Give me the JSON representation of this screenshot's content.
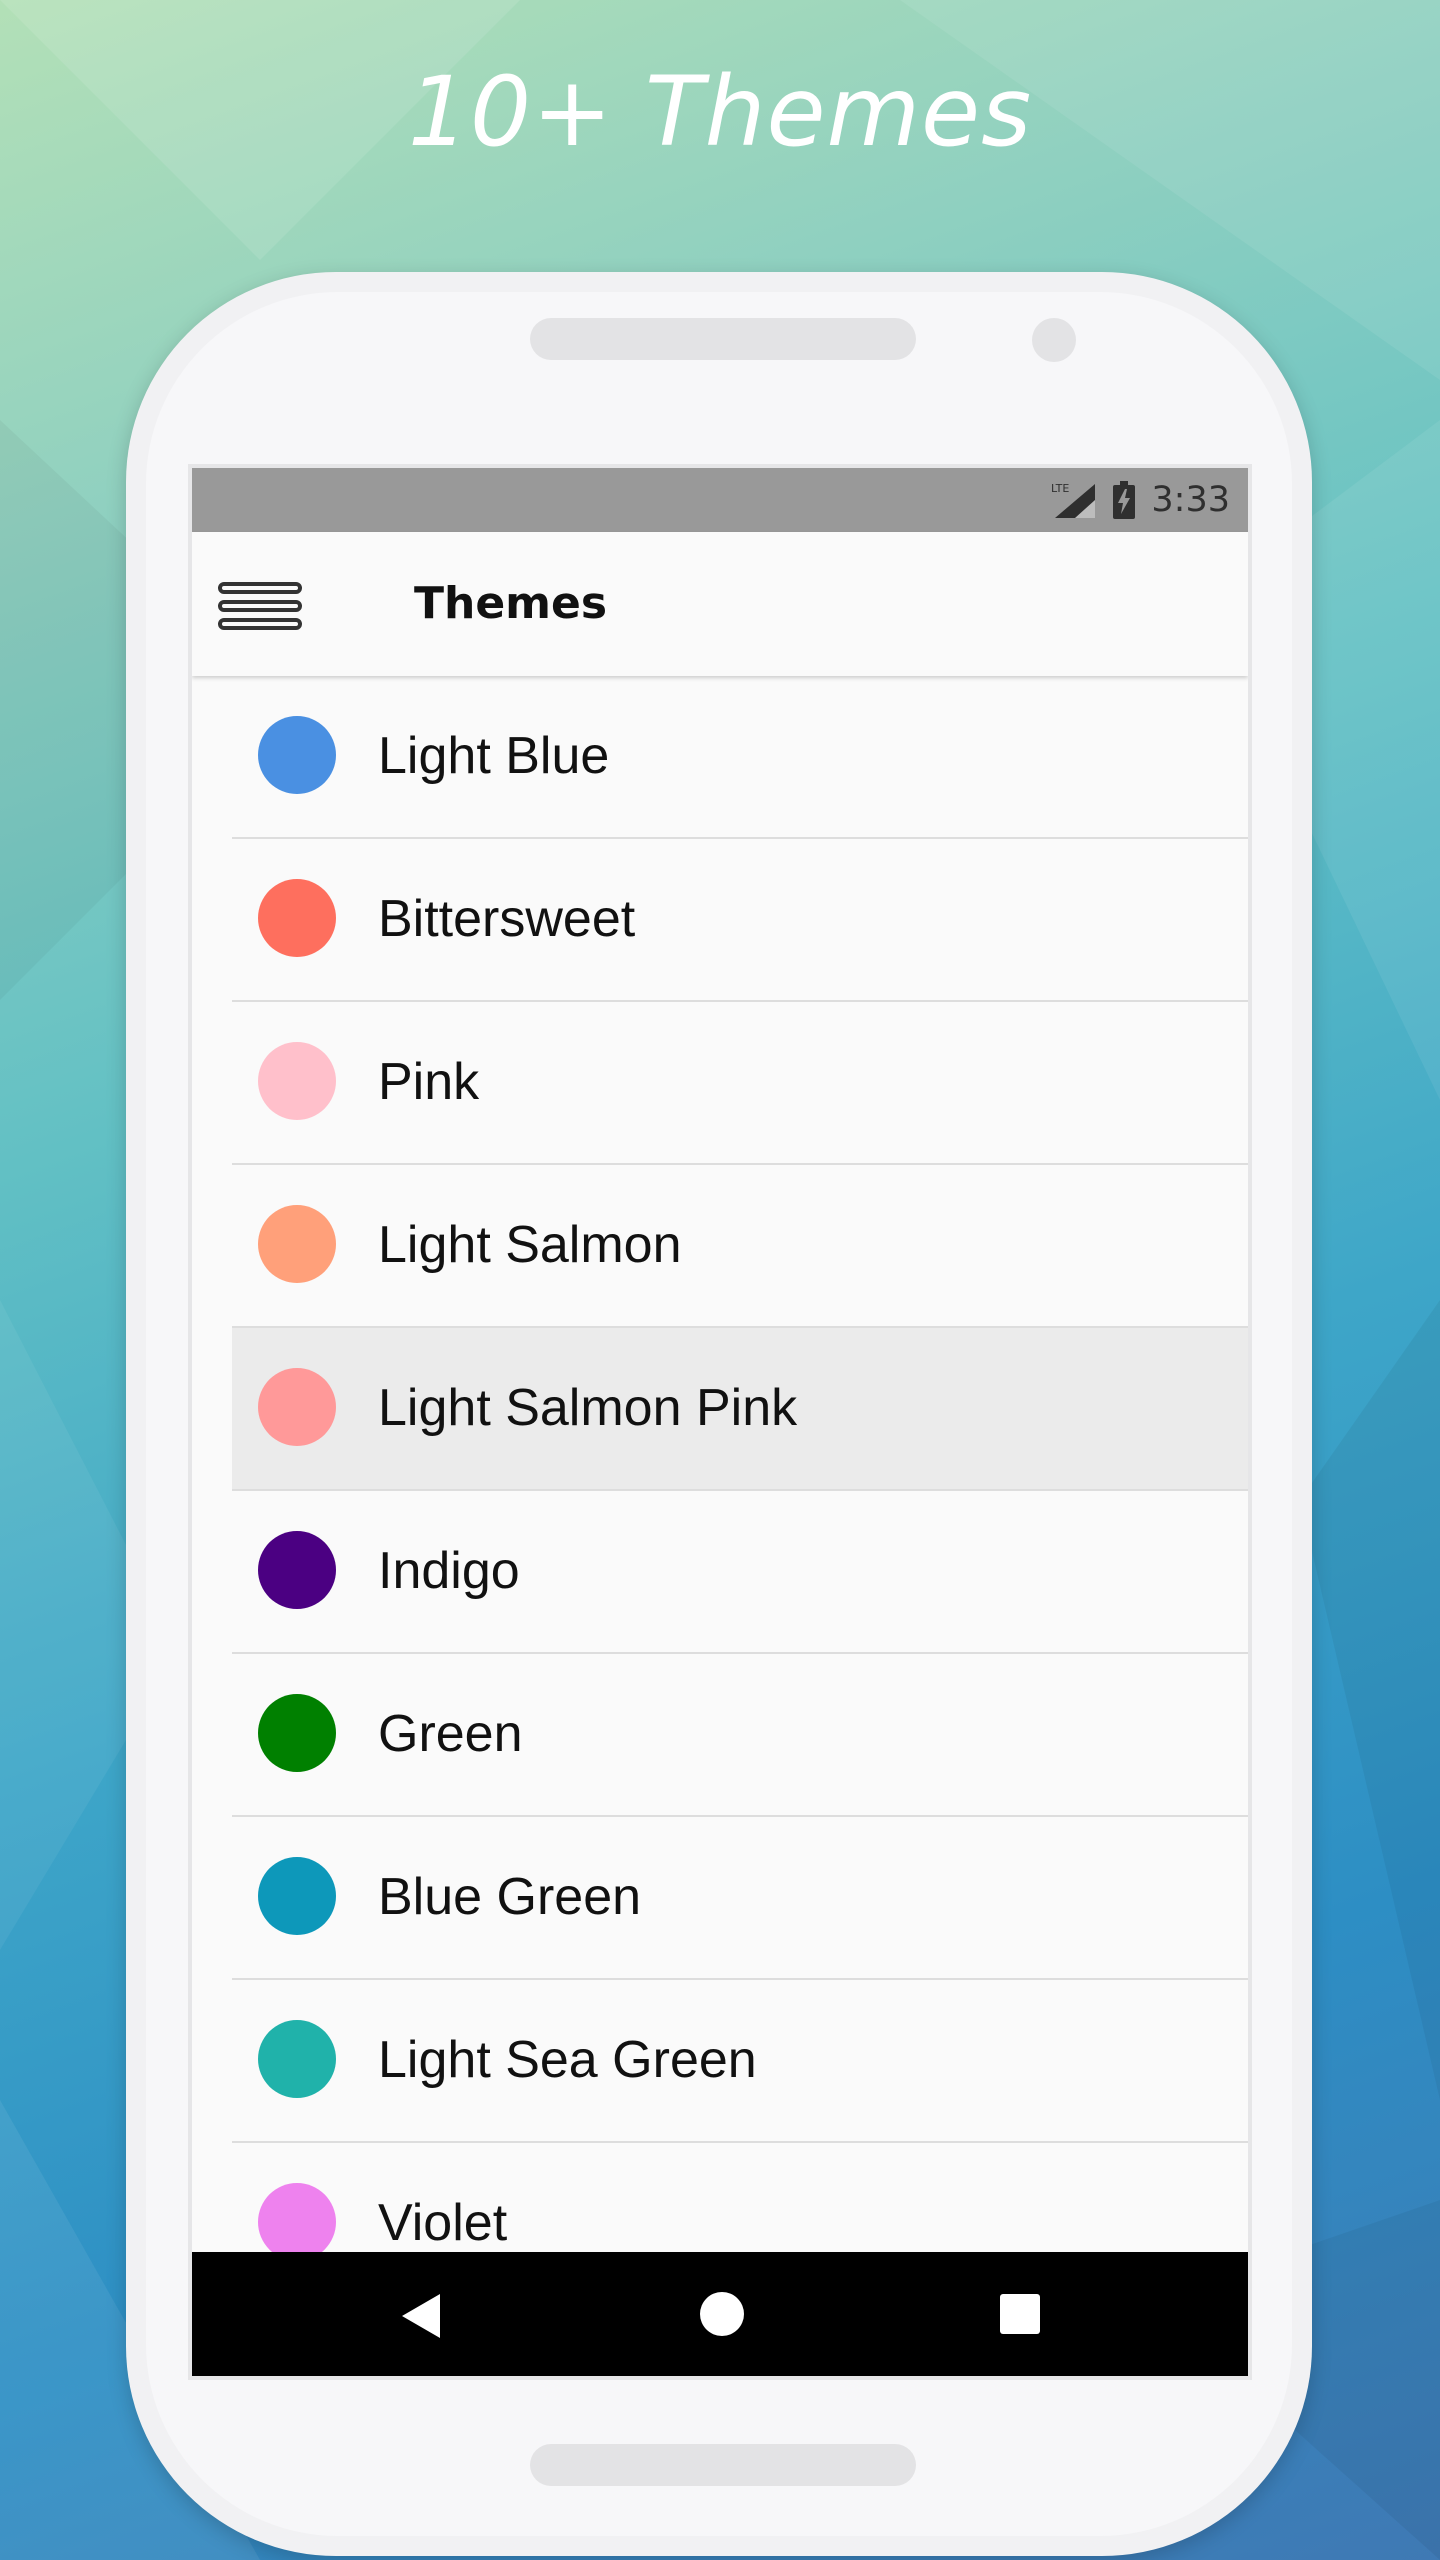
{
  "headline": "10+ Themes",
  "status_bar": {
    "network": "LTE",
    "time": "3:33"
  },
  "appbar": {
    "title": "Themes",
    "menu_icon": "hamburger-menu-icon"
  },
  "themes": [
    {
      "label": "Light Blue",
      "color": "#4a90e2"
    },
    {
      "label": "Bittersweet",
      "color": "#fe6f5e"
    },
    {
      "label": "Pink",
      "color": "#ffc0cb"
    },
    {
      "label": "Light Salmon",
      "color": "#ffa07a"
    },
    {
      "label": "Light Salmon Pink",
      "color": "#ff9999",
      "selected": true
    },
    {
      "label": "Indigo",
      "color": "#4b0082"
    },
    {
      "label": "Green",
      "color": "#008000"
    },
    {
      "label": "Blue Green",
      "color": "#0d98ba"
    },
    {
      "label": "Light Sea Green",
      "color": "#20b2aa"
    },
    {
      "label": "Violet",
      "color": "#ee82ee"
    }
  ],
  "nav_bar": {
    "back_icon": "back-triangle-icon",
    "home_icon": "home-circle-icon",
    "recent_icon": "recent-apps-square-icon"
  }
}
